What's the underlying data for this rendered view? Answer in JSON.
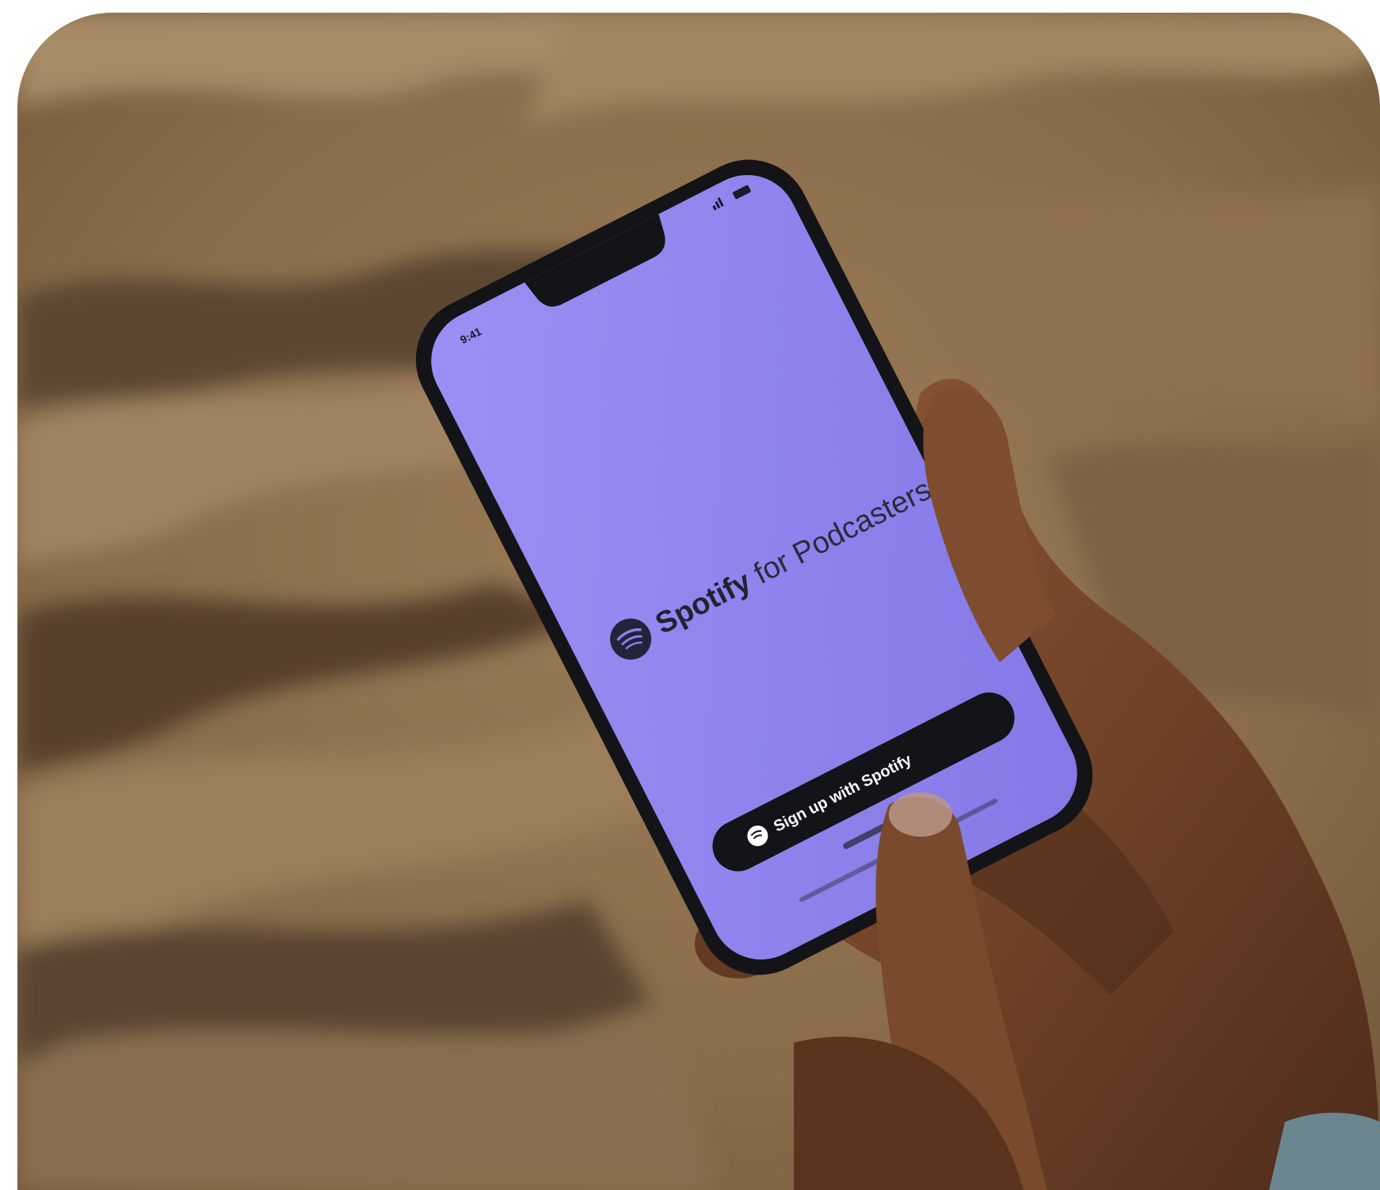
{
  "photo": {
    "description_colors": {
      "screen": "#8b80ee",
      "phone_frame": "#141418",
      "skin": "#7a4a2e",
      "background": "#8e7250"
    },
    "phone": {
      "status_time": "9:41",
      "brand_bold": "Spotify",
      "brand_light": " for Podcasters",
      "signup_button": "Sign up with Spotify"
    }
  }
}
